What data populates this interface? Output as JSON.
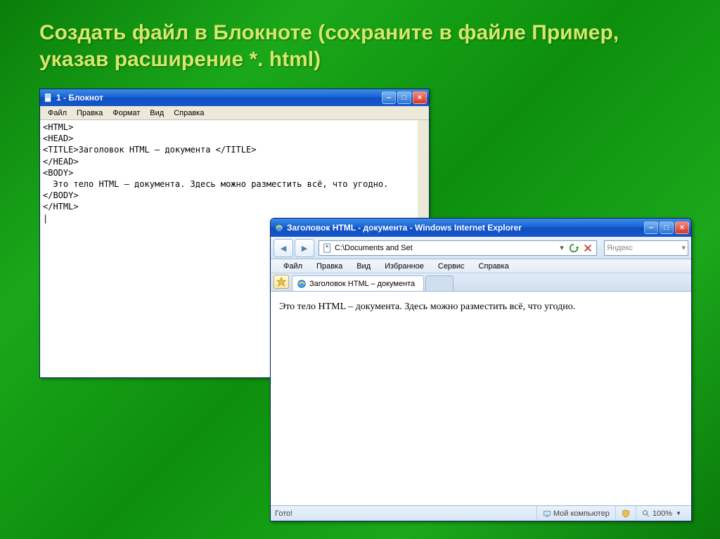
{
  "slide": {
    "title": "Создать файл в Блокноте (сохраните в файле Пример,  указав расширение  *. html)"
  },
  "notepad": {
    "title": "1 - Блокнот",
    "menu": {
      "file": "Файл",
      "edit": "Правка",
      "format": "Формат",
      "view": "Вид",
      "help": "Справка"
    },
    "body_lines": [
      "<HTML>",
      "<HEAD>",
      "<TITLE>Заголовок HTML – документа </TITLE>",
      "</HEAD>",
      "<BODY>",
      "  Это тело HTML – документа. Здесь можно разместить всё, что угодно.",
      "</BODY>",
      "</HTML>",
      "|"
    ]
  },
  "ie": {
    "title": "Заголовок HTML - документа - Windows Internet Explorer",
    "address": "C:\\Documents and Set",
    "refresh_label": "",
    "stop_label": "",
    "search_placeholder": "Яндекс",
    "menu": {
      "file": "Файл",
      "edit": "Правка",
      "view": "Вид",
      "favorites": "Избранное",
      "tools": "Сервис",
      "help": "Справка"
    },
    "tab_label": "Заголовок HTML – документа",
    "body_text": "Это тело HTML – документа. Здесь можно разместить всё, что угодно.",
    "status": {
      "ready": "Гото!",
      "zone": "Мой компьютер",
      "zoom": "100%"
    }
  }
}
